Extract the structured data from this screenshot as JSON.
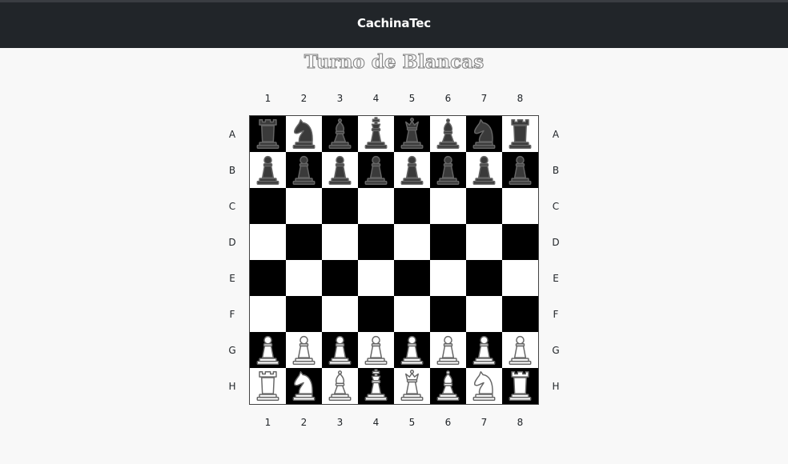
{
  "navbar": {
    "brand": "CachinaTec"
  },
  "status": {
    "turn_text": "Turno de Blancas"
  },
  "board": {
    "columns": [
      "1",
      "2",
      "3",
      "4",
      "5",
      "6",
      "7",
      "8"
    ],
    "rows": [
      "A",
      "B",
      "C",
      "D",
      "E",
      "F",
      "G",
      "H"
    ],
    "pieces": [
      [
        "br",
        "bn",
        "bb",
        "bk",
        "bq",
        "bb",
        "bn",
        "br"
      ],
      [
        "bp",
        "bp",
        "bp",
        "bp",
        "bp",
        "bp",
        "bp",
        "bp"
      ],
      [
        "",
        "",
        "",
        "",
        "",
        "",
        "",
        ""
      ],
      [
        "",
        "",
        "",
        "",
        "",
        "",
        "",
        ""
      ],
      [
        "",
        "",
        "",
        "",
        "",
        "",
        "",
        ""
      ],
      [
        "",
        "",
        "",
        "",
        "",
        "",
        "",
        ""
      ],
      [
        "wp",
        "wp",
        "wp",
        "wp",
        "wp",
        "wp",
        "wp",
        "wp"
      ],
      [
        "wr",
        "wn",
        "wb",
        "wk",
        "wq",
        "wb",
        "wn",
        "wr"
      ]
    ],
    "colors": {
      "dark_square": "#000000",
      "light_square": "#ffffff",
      "black_piece": "#3a3a3a",
      "white_piece": "#ffffff",
      "piece_outline": "#666666"
    }
  }
}
